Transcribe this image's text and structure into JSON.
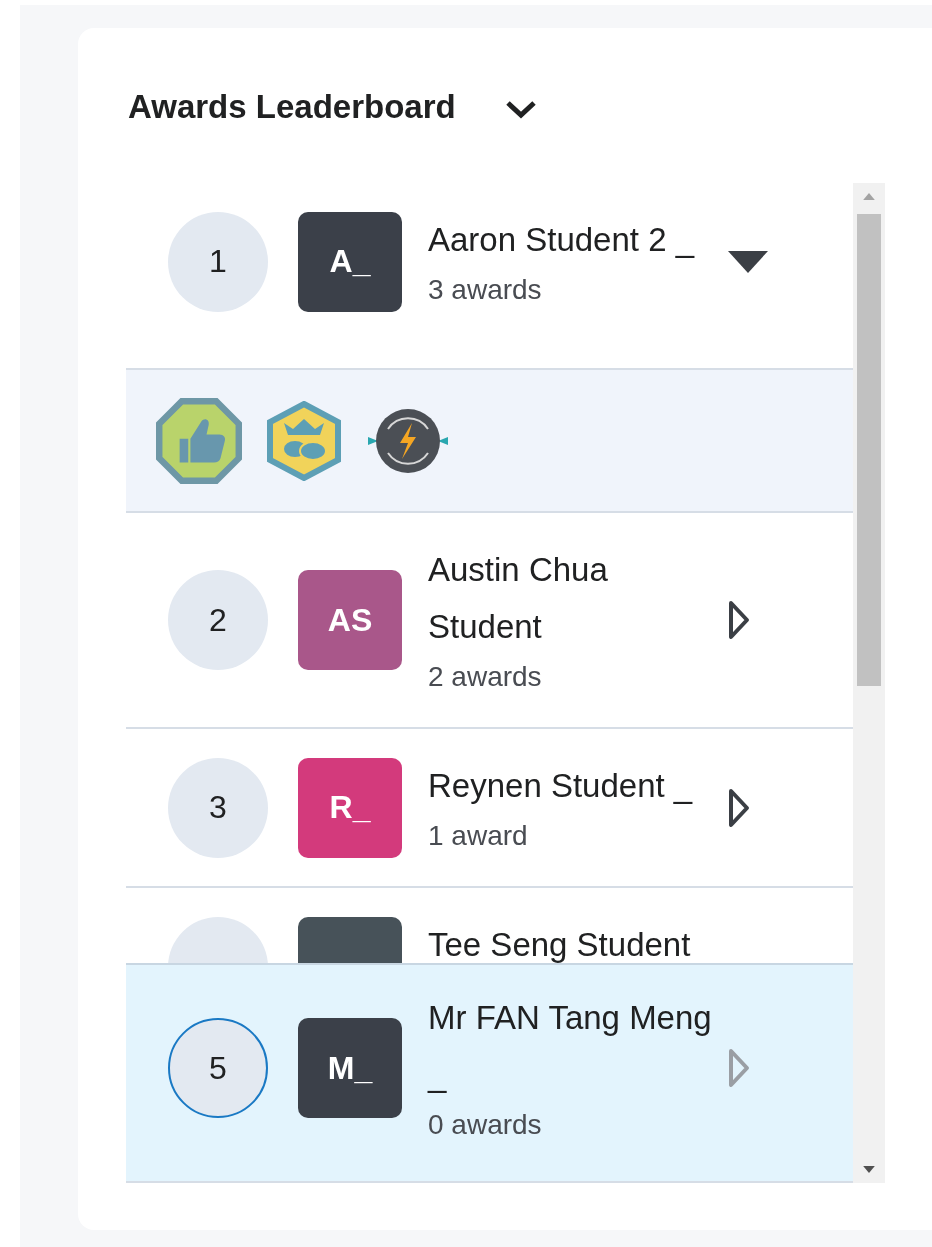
{
  "title": "Awards Leaderboard",
  "rows": [
    {
      "rank": "1",
      "initials": "A_",
      "color": "#3b4049",
      "name": "Aaron Student 2 _",
      "awards_count": "3 awards",
      "expanded": true,
      "awards": [
        {
          "kind": "thumbs-up"
        },
        {
          "kind": "crown-chat"
        },
        {
          "kind": "lightning"
        }
      ]
    },
    {
      "rank": "2",
      "initials": "AS",
      "color": "#a9578a",
      "name": "Austin Chua Student",
      "awards_count": "2 awards",
      "expanded": false
    },
    {
      "rank": "3",
      "initials": "R_",
      "color": "#d33a7c",
      "name": "Reynen Student _",
      "awards_count": "1 award",
      "expanded": false
    }
  ],
  "covered_row": {
    "name": "Tee Seng Student",
    "color": "#475259"
  },
  "current_user_row": {
    "rank": "5",
    "initials": "M_",
    "color": "#3b4049",
    "name": "Mr FAN Tang Meng _",
    "awards_count": "0 awards",
    "expanded": false,
    "disabled": true
  }
}
